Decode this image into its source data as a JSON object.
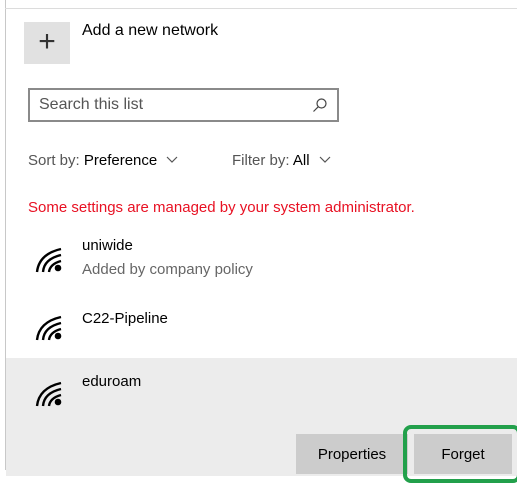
{
  "add_network": {
    "icon": "plus-icon",
    "label": "Add a new network"
  },
  "search": {
    "placeholder": "Search this list",
    "value": ""
  },
  "sort": {
    "label": "Sort by:",
    "value": "Preference"
  },
  "filter": {
    "label": "Filter by:",
    "value": "All"
  },
  "admin_message": "Some settings are managed by your system administrator.",
  "networks": [
    {
      "name": "uniwide",
      "subtitle": "Added by company policy",
      "icon": "wifi-icon"
    },
    {
      "name": "C22-Pipeline",
      "subtitle": "",
      "icon": "wifi-icon"
    },
    {
      "name": "eduroam",
      "subtitle": "",
      "icon": "wifi-icon",
      "selected": true
    }
  ],
  "actions": {
    "properties_label": "Properties",
    "forget_label": "Forget"
  },
  "colors": {
    "warning_text": "#e81123",
    "highlight": "#22a04b",
    "button_bg": "#cccccc",
    "selected_bg": "#ececec"
  }
}
